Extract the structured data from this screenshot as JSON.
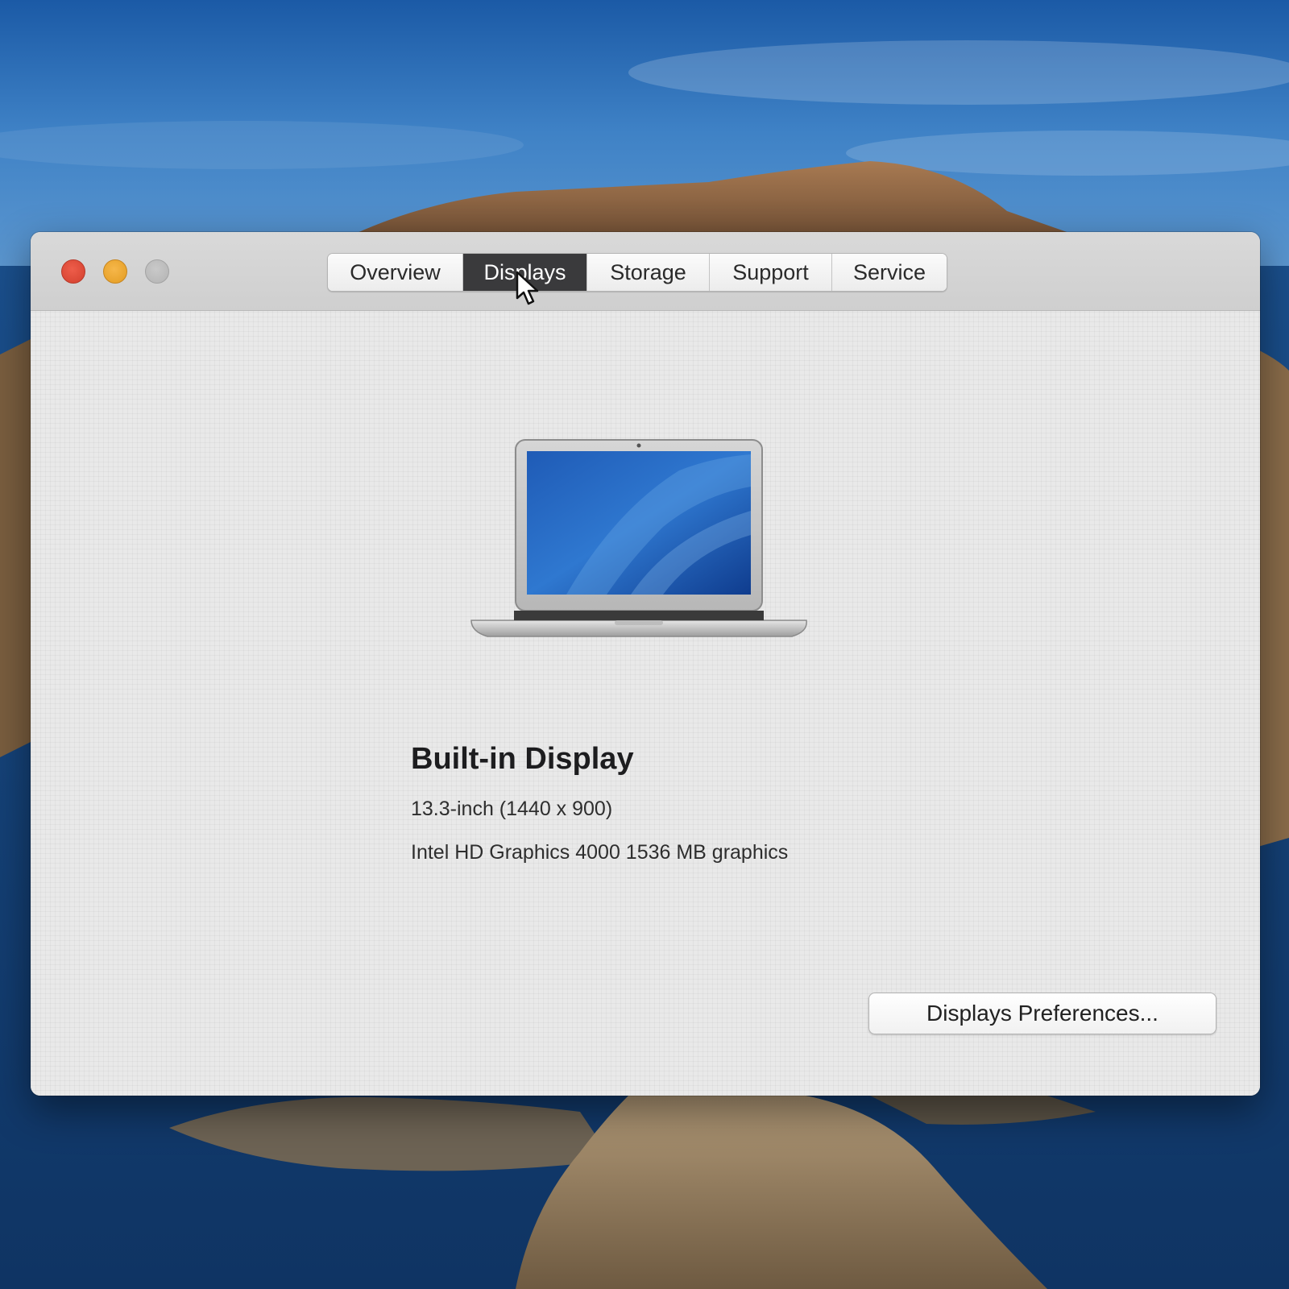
{
  "tabs": [
    {
      "label": "Overview",
      "active": false
    },
    {
      "label": "Displays",
      "active": true
    },
    {
      "label": "Storage",
      "active": false
    },
    {
      "label": "Support",
      "active": false
    },
    {
      "label": "Service",
      "active": false
    }
  ],
  "display": {
    "name": "Built-in Display",
    "size": "13.3-inch (1440 x 900)",
    "graphics": "Intel HD Graphics 4000 1536 MB graphics"
  },
  "buttons": {
    "preferences_label": "Displays Preferences..."
  },
  "icons": {
    "laptop": "laptop-icon",
    "cursor": "arrow-cursor-icon"
  },
  "colors": {
    "close": "#e24e3c",
    "minimize": "#eea533",
    "zoom": "#bdbdbd",
    "active_tab": "#3a3a3c"
  }
}
